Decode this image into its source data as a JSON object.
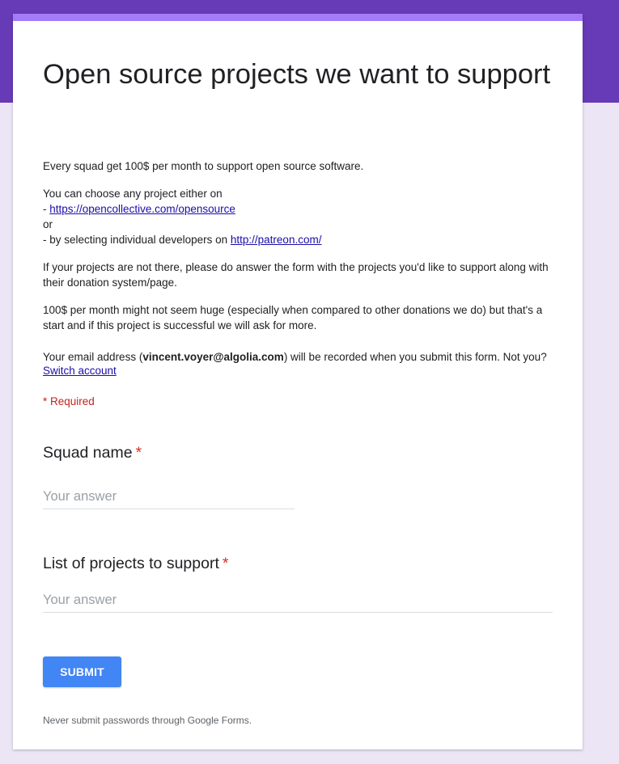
{
  "form": {
    "title": "Open source projects we want to support",
    "description": {
      "line1": "Every squad get 100$ per month to support open source software.",
      "choose_intro": "You can choose any project either on",
      "dash1": "- ",
      "link_opencollective": "https://opencollective.com/opensource",
      "or": "or",
      "dash2_text": "- by selecting individual developers on ",
      "link_patreon": "http://patreon.com/",
      "paragraph3": "If your projects are not there, please do answer the form with the projects you'd like to support along with their donation system/page.",
      "paragraph4": "100$ per month might not seem huge (especially when compared to other donations we do)  but that's a start and if this project is successful we will ask for more."
    },
    "email_notice": {
      "prefix": "Your email address (",
      "email": "vincent.voyer@algolia.com",
      "suffix": ") will be recorded when you submit this form. Not you? ",
      "switch_account": "Switch account"
    },
    "required_note": "* Required",
    "questions": [
      {
        "label": "Squad name",
        "required_mark": "*",
        "placeholder": "Your answer"
      },
      {
        "label": "List of projects to support",
        "required_mark": "*",
        "placeholder": "Your answer"
      }
    ],
    "submit_label": "SUBMIT",
    "footer": "Never submit passwords through Google Forms."
  },
  "colors": {
    "header_band": "#673ab7",
    "card_accent": "#a37bf6",
    "background": "#ebe5f6",
    "submit_button": "#4285f4",
    "required": "#d93025",
    "link": "#1a0dab"
  }
}
